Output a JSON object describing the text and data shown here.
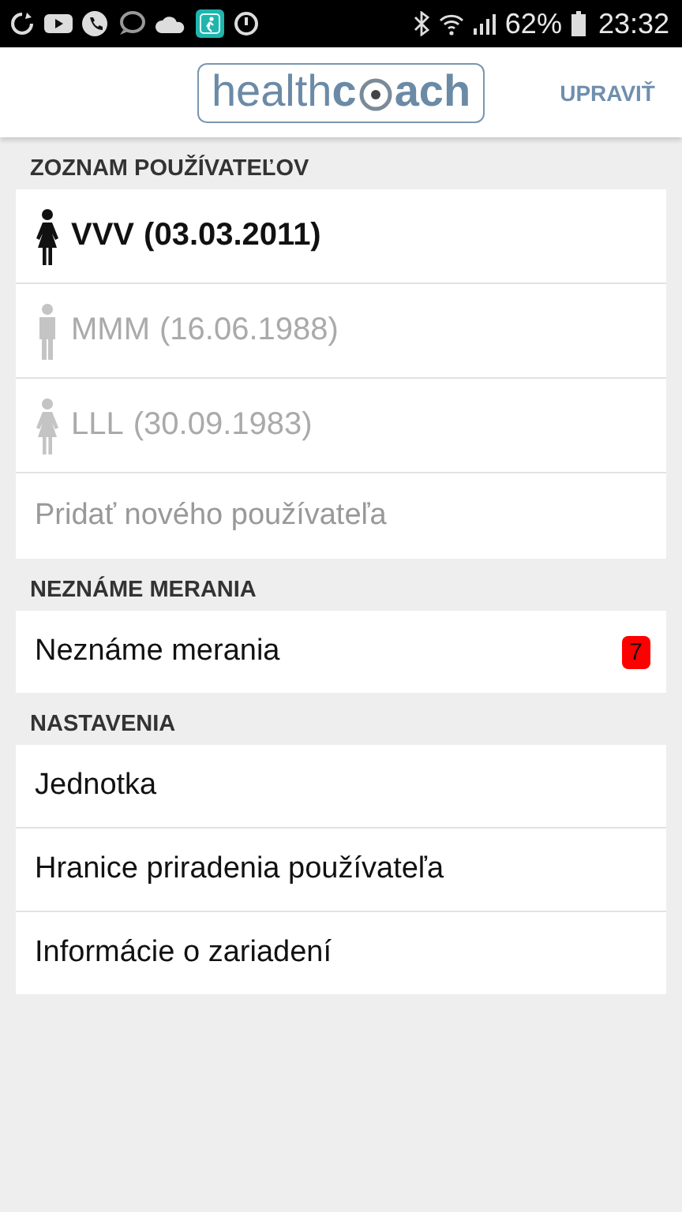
{
  "status_bar": {
    "battery": "62%",
    "time": "23:32"
  },
  "header": {
    "logo": {
      "light": "health",
      "bold_before": "c",
      "bold_after": "ach"
    },
    "action": "UPRAVIŤ"
  },
  "sections": [
    {
      "title": "ZOZNAM POUŽÍVATEĽOV",
      "items": [
        {
          "kind": "female",
          "name": "VVV",
          "date": "(03.03.2011)",
          "selected": true
        },
        {
          "kind": "male",
          "name": "MMM",
          "date": "(16.06.1988)",
          "selected": false
        },
        {
          "kind": "female",
          "name": "LLL",
          "date": "(30.09.1983)",
          "selected": false
        },
        {
          "kind": "add",
          "label": "Pridať nového používateľa"
        }
      ]
    },
    {
      "title": "NEZNÁME MERANIA",
      "items": [
        {
          "kind": "link",
          "label": "Neznáme merania",
          "badge": "7"
        }
      ]
    },
    {
      "title": "NASTAVENIA",
      "items": [
        {
          "kind": "link",
          "label": "Jednotka"
        },
        {
          "kind": "link",
          "label": "Hranice priradenia používateľa"
        },
        {
          "kind": "link",
          "label": "Informácie o zariadení"
        }
      ]
    }
  ]
}
